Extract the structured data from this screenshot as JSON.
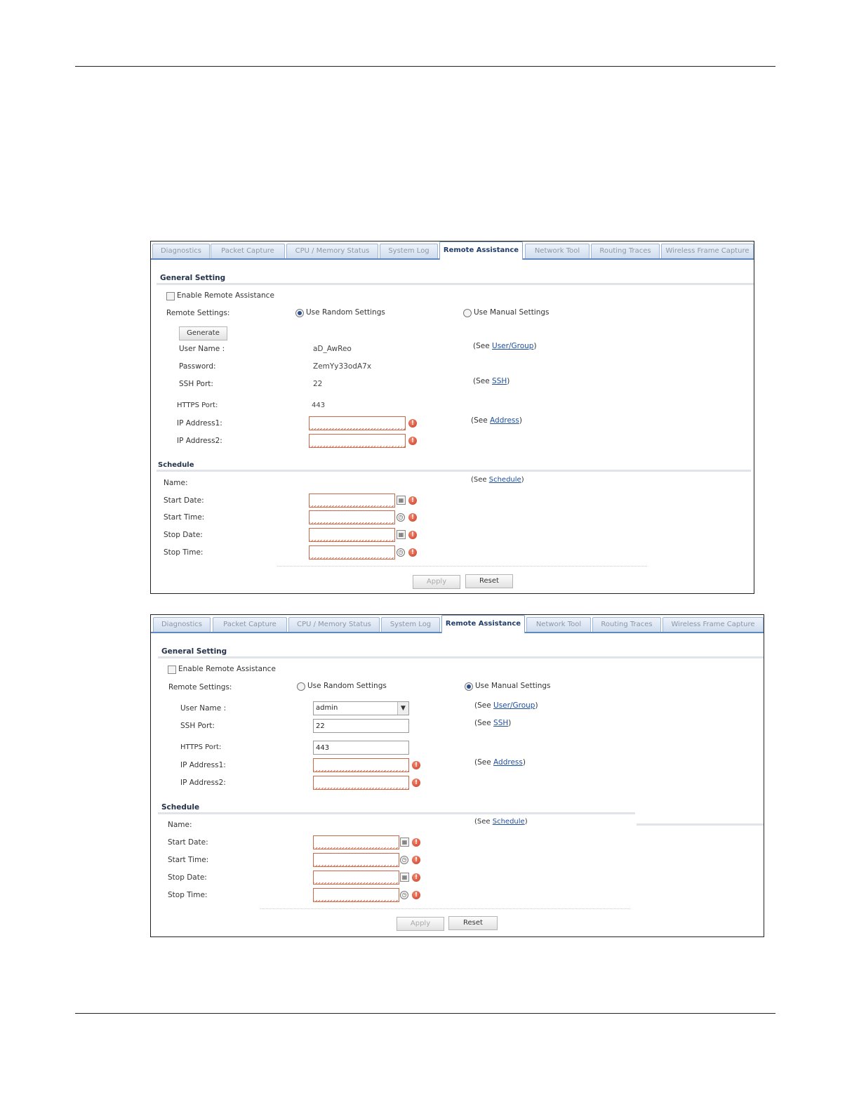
{
  "tabs": [
    {
      "label": "Diagnostics"
    },
    {
      "label": "Packet Capture"
    },
    {
      "label": "CPU / Memory Status"
    },
    {
      "label": "System Log"
    },
    {
      "label": "Remote Assistance"
    },
    {
      "label": "Network Tool"
    },
    {
      "label": "Routing Traces"
    },
    {
      "label": "Wireless Frame Capture"
    }
  ],
  "active_tab": "Remote Assistance",
  "colors": {
    "active_tab_border": "#5f87c0",
    "error_icon": "#cc3b22",
    "link": "#1f4fa0"
  },
  "panel1": {
    "general_heading": "General Setting",
    "enable_label": "Enable Remote Assistance",
    "remote_settings_label": "Remote Settings:",
    "random_label": "Use Random Settings",
    "manual_label": "Use Manual Settings",
    "selected_mode": "random",
    "generate_label": "Generate",
    "username_label": "User Name :",
    "username_value": "aD_AwReo",
    "password_label": "Password:",
    "password_value": "ZemYy33odA7x",
    "ssh_label": "SSH Port:",
    "ssh_value": "22",
    "https_label": "HTTPS Port:",
    "https_value": "443",
    "ip1_label": "IP Address1:",
    "ip2_label": "IP Address2:",
    "see_prefix": "(See ",
    "see_suffix": ")",
    "see_user_link": "User/Group",
    "see_ssh_link": "SSH",
    "see_address_link": "Address",
    "schedule_heading": "Schedule",
    "name_label": "Name:",
    "see_schedule_link": "Schedule",
    "start_date_label": "Start Date:",
    "start_time_label": "Start Time:",
    "stop_date_label": "Stop Date:",
    "stop_time_label": "Stop Time:",
    "apply_label": "Apply",
    "reset_label": "Reset"
  },
  "panel2": {
    "general_heading": "General Setting",
    "enable_label": "Enable Remote Assistance",
    "remote_settings_label": "Remote Settings:",
    "random_label": "Use Random Settings",
    "manual_label": "Use Manual Settings",
    "selected_mode": "manual",
    "username_label": "User Name :",
    "username_value": "admin",
    "ssh_label": "SSH Port:",
    "ssh_value": "22",
    "https_label": "HTTPS Port:",
    "https_value": "443",
    "ip1_label": "IP Address1:",
    "ip2_label": "IP Address2:",
    "see_prefix": "(See ",
    "see_suffix": ")",
    "see_user_link": "User/Group",
    "see_ssh_link": "SSH",
    "see_address_link": "Address",
    "schedule_heading": "Schedule",
    "name_label": "Name:",
    "see_schedule_link": "Schedule",
    "start_date_label": "Start Date:",
    "start_time_label": "Start Time:",
    "stop_date_label": "Stop Date:",
    "stop_time_label": "Stop Time:",
    "apply_label": "Apply",
    "reset_label": "Reset"
  }
}
